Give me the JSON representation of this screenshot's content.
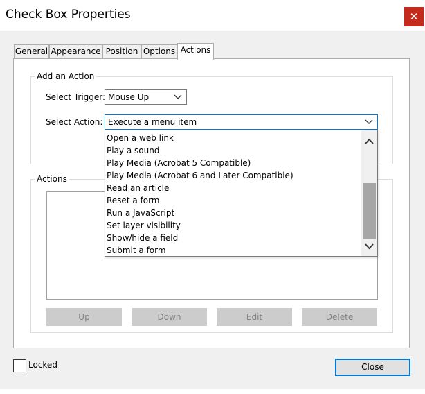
{
  "window": {
    "title": "Check Box Properties",
    "close_glyph": "✕"
  },
  "tabs": [
    {
      "label": "General"
    },
    {
      "label": "Appearance"
    },
    {
      "label": "Position"
    },
    {
      "label": "Options"
    },
    {
      "label": "Actions",
      "active": true
    }
  ],
  "add_action": {
    "legend": "Add an Action",
    "trigger_label": "Select Trigger:",
    "trigger_value": "Mouse Up",
    "action_label": "Select Action:",
    "action_value": "Execute a menu item"
  },
  "action_options": [
    "Open a web link",
    "Play a sound",
    "Play Media (Acrobat 5 Compatible)",
    "Play Media (Acrobat 6 and Later Compatible)",
    "Read an article",
    "Reset a form",
    "Run a JavaScript",
    "Set layer visibility",
    "Show/hide a field",
    "Submit a form"
  ],
  "actions_group": {
    "legend": "Actions",
    "buttons": {
      "up": "Up",
      "down": "Down",
      "edit": "Edit",
      "delete": "Delete"
    }
  },
  "footer": {
    "locked_label": "Locked",
    "close_label": "Close"
  },
  "colors": {
    "close_hover_red": "#c42b1c",
    "focus_blue": "#0078d7"
  }
}
